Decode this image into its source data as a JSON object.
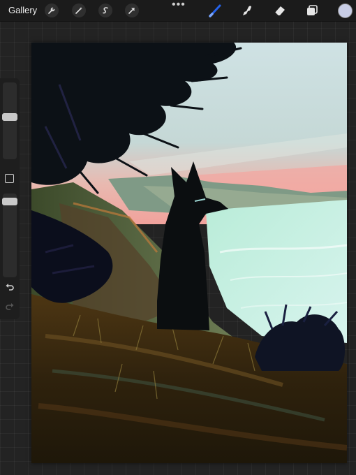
{
  "toolbar": {
    "gallery_label": "Gallery",
    "left_tools": [
      "wrench-icon",
      "magic-wand-icon",
      "selection-icon",
      "transform-arrow-icon"
    ],
    "more_label": "•••",
    "right_tools": [
      "brush-icon",
      "smudge-icon",
      "eraser-icon",
      "layers-icon"
    ],
    "active_tool": "brush-icon",
    "brush_color": "#2563eb",
    "current_color": "#c8cde6"
  },
  "sidebar": {
    "size_slider_value": 0.45,
    "opacity_slider_value": 0.05,
    "icons": [
      "square-modify-icon",
      "undo-icon",
      "redo-icon"
    ]
  },
  "canvas": {
    "description_colors": {
      "sky": "#c7dcdc",
      "sunset": "#f2a6a0",
      "sea": "#c6f0e4",
      "fox": "#0b0e10",
      "ground": "#3a2a10"
    }
  }
}
